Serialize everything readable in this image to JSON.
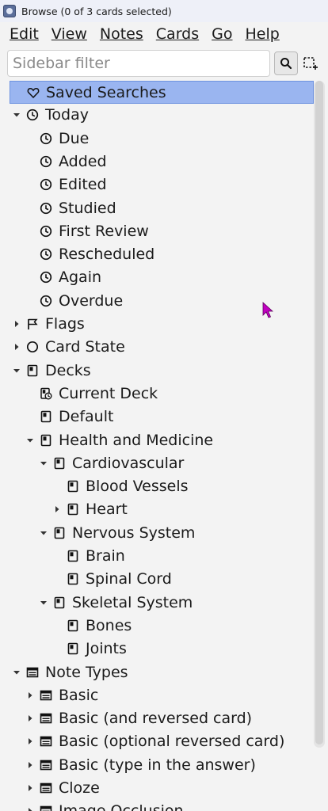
{
  "window": {
    "title": "Browse (0 of 3 cards selected)"
  },
  "menu": [
    {
      "label": "Edit"
    },
    {
      "label": "View"
    },
    {
      "label": "Notes"
    },
    {
      "label": "Cards"
    },
    {
      "label": "Go"
    },
    {
      "label": "Help"
    }
  ],
  "filter": {
    "placeholder": "Sidebar filter",
    "value": ""
  },
  "tree": [
    {
      "label": "Saved Searches",
      "icon": "heart-icon",
      "level": 0,
      "expander": "none",
      "selected": true
    },
    {
      "label": "Today",
      "icon": "clock-icon",
      "level": 0,
      "expander": "expanded"
    },
    {
      "label": "Due",
      "icon": "clock-icon",
      "level": 1,
      "expander": "none"
    },
    {
      "label": "Added",
      "icon": "clock-icon",
      "level": 1,
      "expander": "none"
    },
    {
      "label": "Edited",
      "icon": "clock-icon",
      "level": 1,
      "expander": "none"
    },
    {
      "label": "Studied",
      "icon": "clock-icon",
      "level": 1,
      "expander": "none"
    },
    {
      "label": "First Review",
      "icon": "clock-icon",
      "level": 1,
      "expander": "none"
    },
    {
      "label": "Rescheduled",
      "icon": "clock-icon",
      "level": 1,
      "expander": "none"
    },
    {
      "label": "Again",
      "icon": "clock-icon",
      "level": 1,
      "expander": "none"
    },
    {
      "label": "Overdue",
      "icon": "clock-icon",
      "level": 1,
      "expander": "none"
    },
    {
      "label": "Flags",
      "icon": "flag-icon",
      "level": 0,
      "expander": "collapsed"
    },
    {
      "label": "Card State",
      "icon": "circle-icon",
      "level": 0,
      "expander": "collapsed"
    },
    {
      "label": "Decks",
      "icon": "deck-icon",
      "level": 0,
      "expander": "expanded"
    },
    {
      "label": "Current Deck",
      "icon": "current-deck-icon",
      "level": 1,
      "expander": "none"
    },
    {
      "label": "Default",
      "icon": "deck-icon",
      "level": 1,
      "expander": "none"
    },
    {
      "label": "Health and Medicine",
      "icon": "deck-icon",
      "level": 1,
      "expander": "expanded"
    },
    {
      "label": "Cardiovascular",
      "icon": "deck-icon",
      "level": 2,
      "expander": "expanded"
    },
    {
      "label": "Blood Vessels",
      "icon": "deck-icon",
      "level": 3,
      "expander": "none"
    },
    {
      "label": "Heart",
      "icon": "deck-icon",
      "level": 3,
      "expander": "collapsed"
    },
    {
      "label": "Nervous System",
      "icon": "deck-icon",
      "level": 2,
      "expander": "expanded"
    },
    {
      "label": "Brain",
      "icon": "deck-icon",
      "level": 3,
      "expander": "none"
    },
    {
      "label": "Spinal Cord",
      "icon": "deck-icon",
      "level": 3,
      "expander": "none"
    },
    {
      "label": "Skeletal System",
      "icon": "deck-icon",
      "level": 2,
      "expander": "expanded"
    },
    {
      "label": "Bones",
      "icon": "deck-icon",
      "level": 3,
      "expander": "none"
    },
    {
      "label": "Joints",
      "icon": "deck-icon",
      "level": 3,
      "expander": "none"
    },
    {
      "label": "Note Types",
      "icon": "notetype-icon",
      "level": 0,
      "expander": "expanded"
    },
    {
      "label": "Basic",
      "icon": "notetype-icon",
      "level": 1,
      "expander": "collapsed"
    },
    {
      "label": "Basic (and reversed card)",
      "icon": "notetype-icon",
      "level": 1,
      "expander": "collapsed"
    },
    {
      "label": "Basic (optional reversed card)",
      "icon": "notetype-icon",
      "level": 1,
      "expander": "collapsed"
    },
    {
      "label": "Basic (type in the answer)",
      "icon": "notetype-icon",
      "level": 1,
      "expander": "collapsed"
    },
    {
      "label": "Cloze",
      "icon": "notetype-icon",
      "level": 1,
      "expander": "collapsed"
    },
    {
      "label": "Image Occlusion",
      "icon": "notetype-icon",
      "level": 1,
      "expander": "collapsed"
    }
  ],
  "colors": {
    "selection_bg": "#9ab5f0",
    "selection_border": "#6f93e0",
    "window_bg": "#f3f3f3",
    "titlebar_bg": "#eef0f8",
    "cursor": "#c000c0"
  }
}
